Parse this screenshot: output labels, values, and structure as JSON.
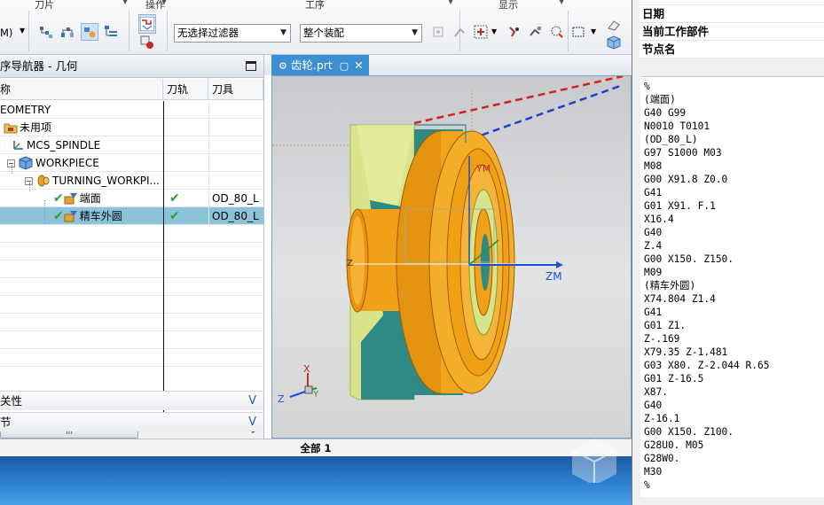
{
  "toolbar": {
    "groups": {
      "tool": "刀片",
      "operation": "操作",
      "process": "工序",
      "display": "显示"
    },
    "cut_label": "M)",
    "filter_combo": "无选择过滤器",
    "assembly_combo": "整个装配"
  },
  "navigator": {
    "title": "序导航器 - 几何",
    "columns": {
      "name": "称",
      "toolpath": "刀轨",
      "tool": "刀具"
    },
    "rows": [
      {
        "label": "EOMETRY",
        "toolpath": "",
        "tool": ""
      },
      {
        "label": "未用项",
        "toolpath": "",
        "tool": ""
      },
      {
        "label": "MCS_SPINDLE",
        "toolpath": "",
        "tool": ""
      },
      {
        "label": "WORKPIECE",
        "toolpath": "",
        "tool": ""
      },
      {
        "label": "TURNING_WORKPI...",
        "toolpath": "",
        "tool": ""
      },
      {
        "label": "端面",
        "toolpath": "✔",
        "tool": "OD_80_L"
      },
      {
        "label": "精车外圆",
        "toolpath": "✔",
        "tool": "OD_80_L"
      }
    ],
    "scroll_grip": "III",
    "sections": [
      "关性",
      "节"
    ]
  },
  "graphics": {
    "tab_label": "齿轮.prt",
    "axes": {
      "zm": "ZM",
      "ym": "YM",
      "z": "Z",
      "x": "X",
      "y": "Y"
    }
  },
  "status": {
    "text": "全部 1"
  },
  "info_panel": {
    "rows": [
      "日期",
      "当前工作部件",
      "节点名"
    ],
    "nc_code": [
      "%",
      "(端面)",
      "G40 G99",
      "N0010 T0101",
      "(OD_80_L)",
      "G97 S1000 M03",
      "M08",
      "G00 X91.8 Z0.0",
      "G41",
      "G01 X91. F.1",
      "X16.4",
      "G40",
      "Z.4",
      "G00 X150. Z150.",
      "M09",
      "(精车外圆)",
      "X74.804 Z1.4",
      "G41",
      "G01 Z1.",
      "Z-.169",
      "X79.35 Z-1.481",
      "G03 X80. Z-2.044 R.65",
      "G01 Z-16.5",
      "X87.",
      "G40",
      "Z-16.1",
      "G00 X150. Z100.",
      "G28U0. M05",
      "G28W0.",
      "M30",
      "%"
    ]
  },
  "colors": {
    "part_orange": "#f2a21a",
    "blank_yellow": "#d9e48a",
    "axis_blue": "#1f4fd8",
    "selection_row": "#8bc4d8",
    "check_green": "#2aa12a"
  }
}
